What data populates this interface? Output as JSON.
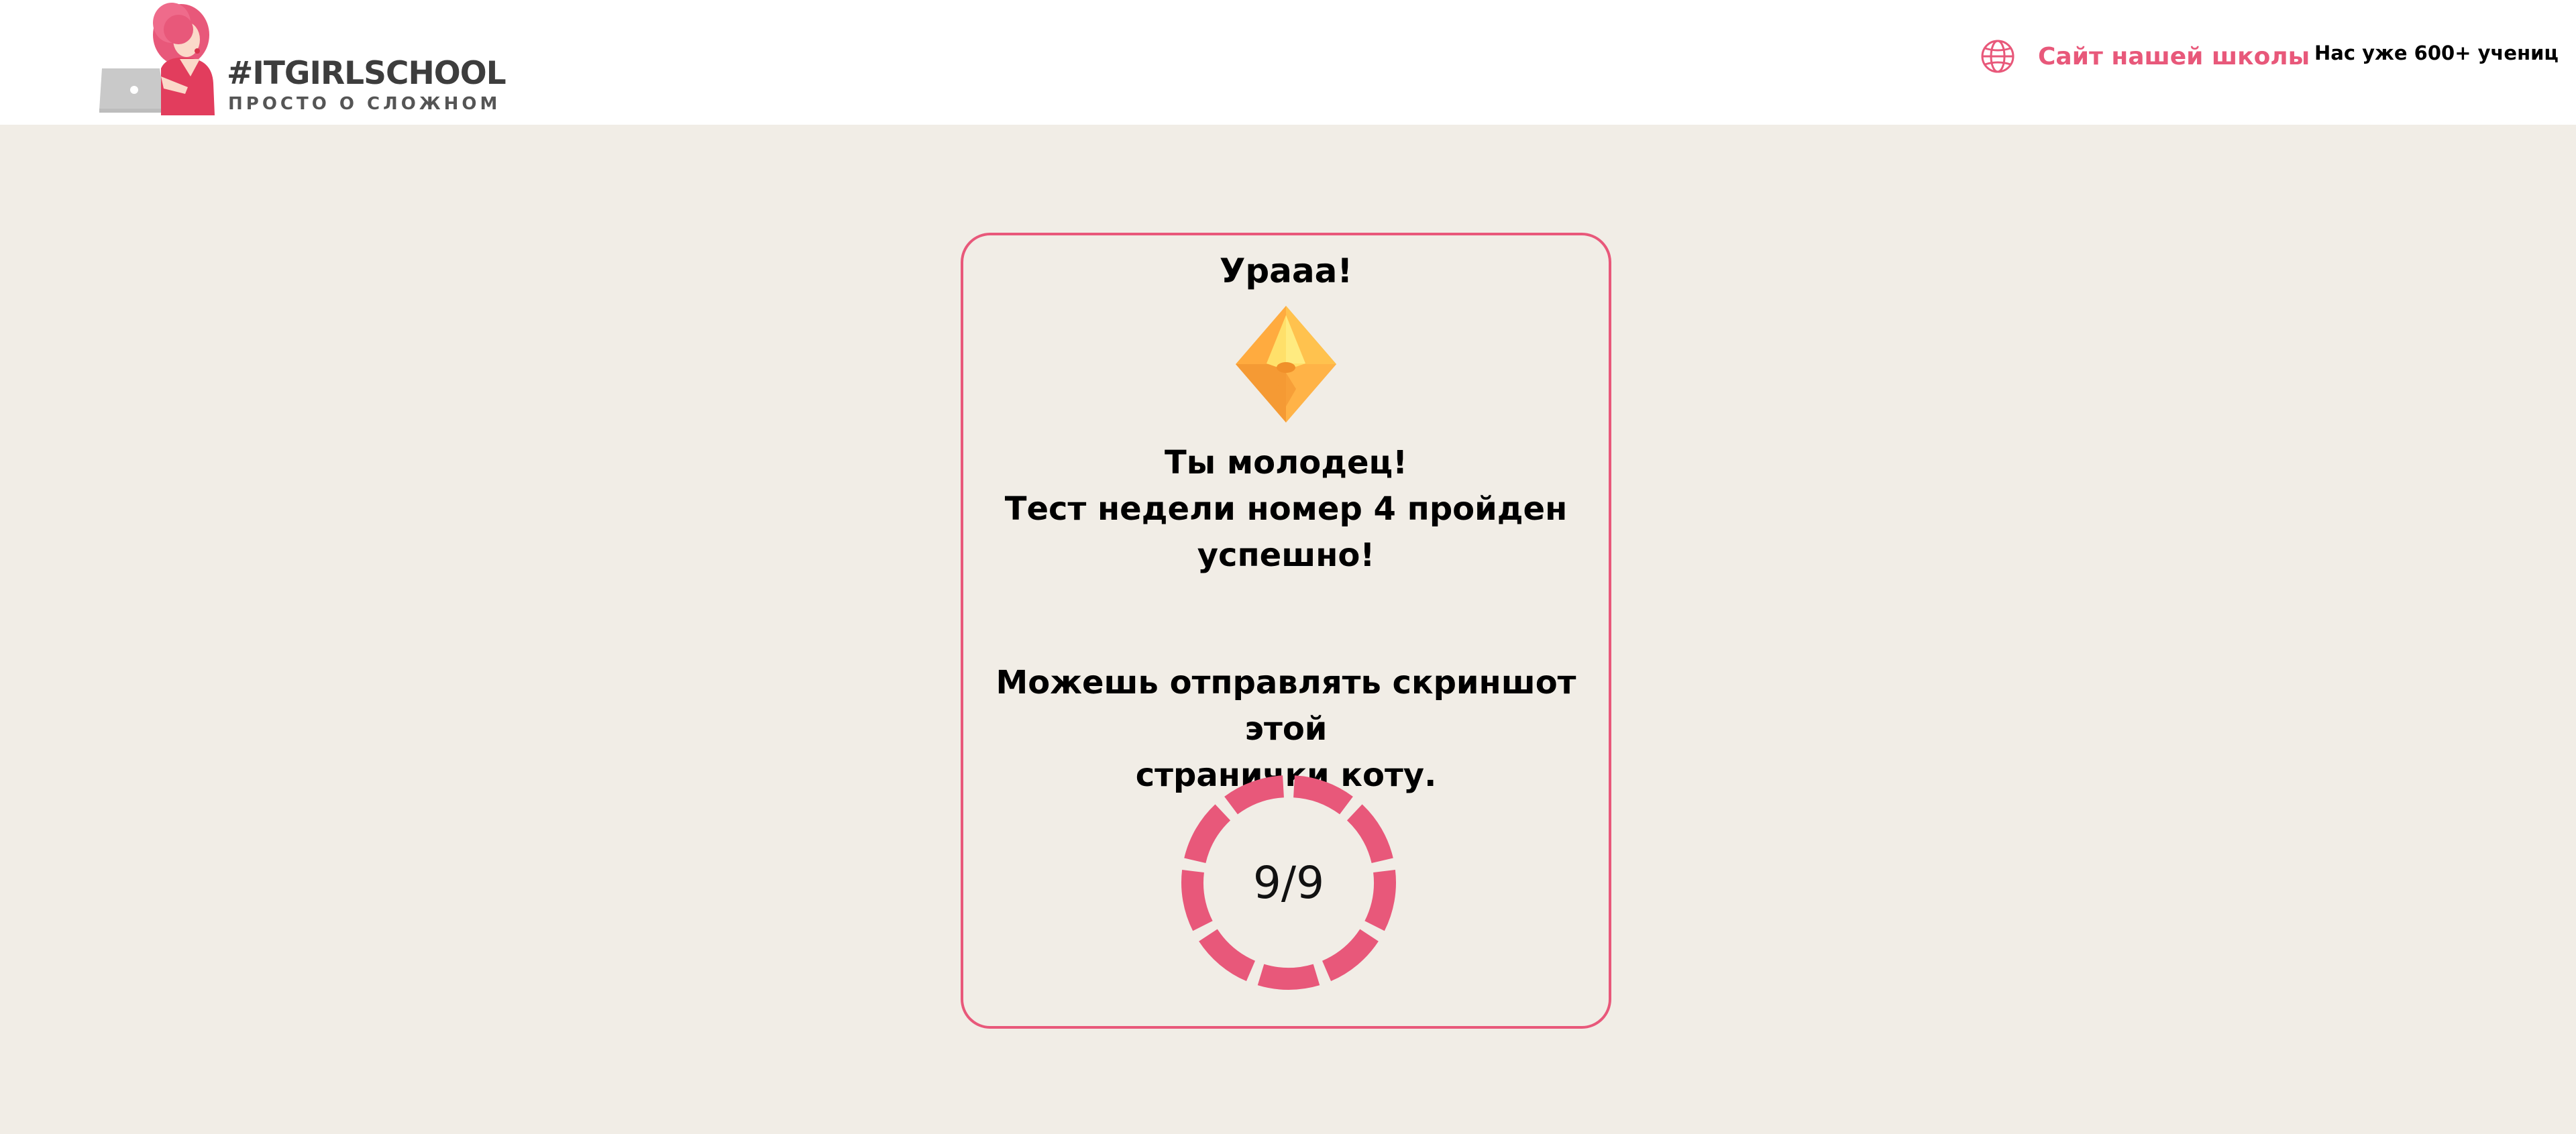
{
  "header": {
    "logo_title": "#ITGIRLSCHOOL",
    "logo_subtitle": "ПРОСТО О СЛОЖНОМ",
    "school_link_label": "Сайт нашей школы",
    "students_count": "Нас уже 600+ учениц"
  },
  "result": {
    "title": "Урааа!",
    "message_lines": [
      "Ты молодец!",
      "Тест недели номер 4 пройден",
      "успешно!"
    ],
    "share_lines": [
      "Можешь отправлять скриншот этой",
      "странички коту."
    ],
    "score": "9/9",
    "correct": 9,
    "total": 9
  },
  "colors": {
    "accent": "#e8587a",
    "background": "#f1ede6",
    "crystal": "#ffab3f"
  },
  "icons": {
    "globe": "globe-icon",
    "crystal": "crystal-icon"
  }
}
